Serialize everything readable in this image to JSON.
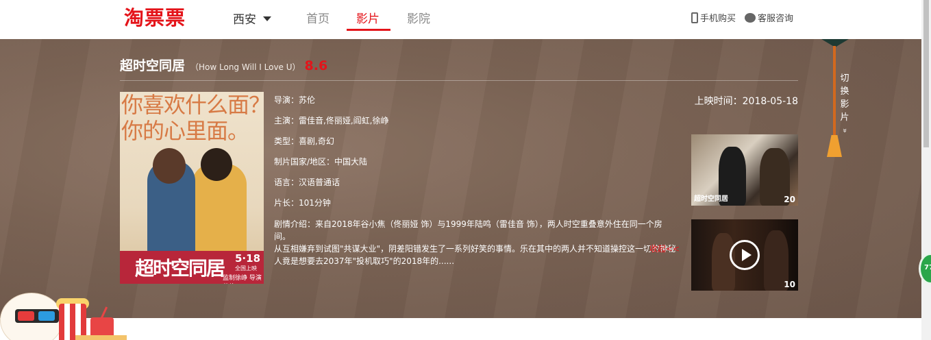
{
  "header": {
    "logo": "淘票票",
    "city": "西安",
    "nav": [
      "首页",
      "影片",
      "影院"
    ],
    "active_nav": "影片",
    "mobile_buy": "手机购买",
    "customer_service": "客服咨询"
  },
  "movie": {
    "title_cn": "超时空同居",
    "title_en": "（How Long Will I Love U）",
    "score": "8.6",
    "director": "导演：苏伦",
    "cast": "主演：雷佳音,佟丽娅,阎虹,徐峥",
    "genre": "类型：喜剧,奇幻",
    "country": "制片国家/地区：中国大陆",
    "language": "语言：汉语普通话",
    "duration": "片长：101分钟",
    "release": "上映时间：2018-05-18",
    "synopsis_line1": "剧情介绍：来自2018年谷小焦（佟丽娅 饰）与1999年陆鸣（雷佳音 饰），两人时空重叠意外住在同一个房间。",
    "synopsis_line2": "从互相嫌弃到试图\"共谋大业\"，阴差阳错发生了一系列好笑的事情。乐在其中的两人并不知道操控这一切的神秘",
    "synopsis_line3": "人竟是想要去2037年\"投机取巧\"的2018年的......",
    "collapse": "收起<<"
  },
  "poster": {
    "slogan_line1": "你喜欢什么面？",
    "slogan_line2": "你的心里面。",
    "title": "超时空同居",
    "date": "5·18",
    "release_note": "全国上映",
    "credits": "监制徐峥 导演苏伦"
  },
  "media": {
    "stills_count": "20",
    "stills_caption": "超时空同居",
    "videos_count": "10"
  },
  "switcher": {
    "label": "切换影片",
    "chevron": "»"
  },
  "badge": "77"
}
